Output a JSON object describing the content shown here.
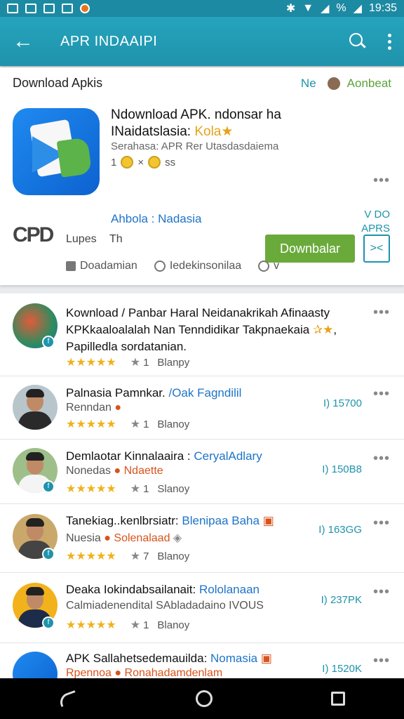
{
  "status": {
    "battery": "%",
    "time": "19:35"
  },
  "appbar": {
    "title": "APR INDAAIPI"
  },
  "featured": {
    "section_title": "Download Apkis",
    "right_link": "Ne",
    "right_label": "Aonbeat",
    "title_line1": "Ndownload APK. ndonsar ha",
    "title_line2": "INaidatslasia:",
    "title_highlight": "Kola",
    "subtitle": "Serahasa: APR Rer Utasdasdaiema",
    "rating": "1",
    "rating_suffix": "ss",
    "download_label": "Downbalar",
    "share_label": "><",
    "dev_link": "Ahbola : Nadasia",
    "vdo_line1": "V DO",
    "vdo_line2": "APRS",
    "logo_text": "CPD",
    "lupes": "Lupes",
    "th": "Th",
    "actions": [
      "Doadamian",
      "Iedekinsonilaa",
      "v"
    ]
  },
  "list": [
    {
      "title1": "Kownload / Panbar Haral Neidanakrikah Afinaasty",
      "title2": "KPKkaaloalalah Nan Tenndidikar Takpnaekaia",
      "title3": "Papilledla sordatanian.",
      "rating_count": "1",
      "rating_label": "Blanpy",
      "meta": ""
    },
    {
      "title_main": "Palnasia Pamnkar.",
      "title_blue": "/Oak Fagndilil",
      "sub_main": "Renndan",
      "sub_orange": "",
      "rating_count": "1",
      "rating_label": "Blanoy",
      "meta": "I) 15700"
    },
    {
      "title_main": "Demlaotar Kinnalaaira :",
      "title_blue": "CeryalAdlary",
      "sub_main": "Nonedas",
      "sub_orange": "Ndaette",
      "rating_count": "1",
      "rating_label": "Slanoy",
      "meta": "I) 150B8"
    },
    {
      "title_main": "Tanekiag..kenlbrsiatr:",
      "title_blue": "Blenipaa Baha",
      "sub_main": "Nuesia",
      "sub_orange": "Solenalaad",
      "rating_count": "7",
      "rating_label": "Blanoy",
      "meta": "I) 163GG"
    },
    {
      "title_main": "Deaka Iokindabsailanait:",
      "title_blue": "Rololanaan",
      "sub_main": "Calmiadenendital SAbladadaino IVOUS",
      "sub_orange": "",
      "rating_count": "1",
      "rating_label": "Blanoy",
      "meta": "I) 237PK"
    },
    {
      "title_main": "APK Sallahetsedemauilda:",
      "title_blue": "Nomasia",
      "sub_main": "Rpennoa",
      "sub_orange": "Ronahadamdenlam",
      "rating_count": "",
      "rating_label": "",
      "meta": "I) 1520K"
    }
  ]
}
